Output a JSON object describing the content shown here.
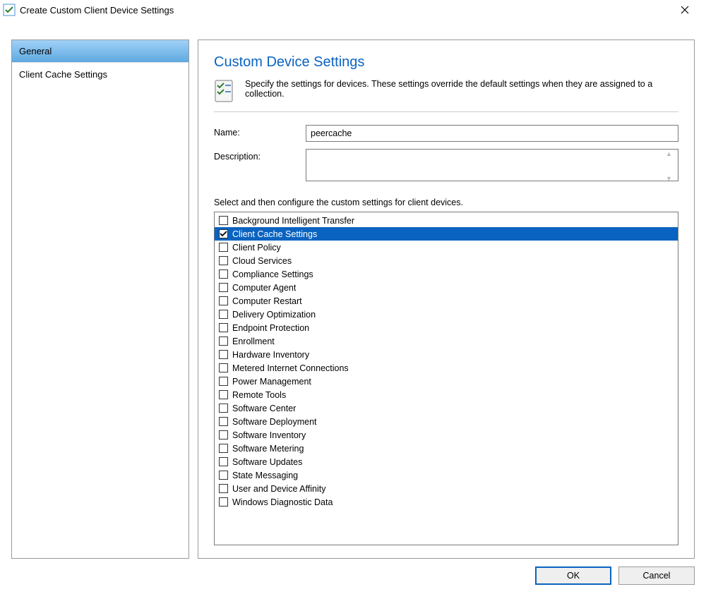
{
  "window": {
    "title": "Create Custom Client Device Settings"
  },
  "nav": {
    "items": [
      {
        "label": "General",
        "selected": true
      },
      {
        "label": "Client Cache Settings",
        "selected": false
      }
    ]
  },
  "content": {
    "heading": "Custom Device Settings",
    "intro": "Specify the settings for devices. These settings override the default settings when they are assigned to a collection.",
    "name_label": "Name:",
    "name_value": "peercache",
    "description_label": "Description:",
    "description_value": "",
    "list_label": "Select and then configure the custom settings for client devices.",
    "options": [
      {
        "label": "Background Intelligent Transfer",
        "checked": false,
        "selected": false
      },
      {
        "label": "Client Cache Settings",
        "checked": true,
        "selected": true
      },
      {
        "label": "Client Policy",
        "checked": false,
        "selected": false
      },
      {
        "label": "Cloud Services",
        "checked": false,
        "selected": false
      },
      {
        "label": "Compliance Settings",
        "checked": false,
        "selected": false
      },
      {
        "label": "Computer Agent",
        "checked": false,
        "selected": false
      },
      {
        "label": "Computer Restart",
        "checked": false,
        "selected": false
      },
      {
        "label": "Delivery Optimization",
        "checked": false,
        "selected": false
      },
      {
        "label": "Endpoint Protection",
        "checked": false,
        "selected": false
      },
      {
        "label": "Enrollment",
        "checked": false,
        "selected": false
      },
      {
        "label": "Hardware Inventory",
        "checked": false,
        "selected": false
      },
      {
        "label": "Metered Internet Connections",
        "checked": false,
        "selected": false
      },
      {
        "label": "Power Management",
        "checked": false,
        "selected": false
      },
      {
        "label": "Remote Tools",
        "checked": false,
        "selected": false
      },
      {
        "label": "Software Center",
        "checked": false,
        "selected": false
      },
      {
        "label": "Software Deployment",
        "checked": false,
        "selected": false
      },
      {
        "label": "Software Inventory",
        "checked": false,
        "selected": false
      },
      {
        "label": "Software Metering",
        "checked": false,
        "selected": false
      },
      {
        "label": "Software Updates",
        "checked": false,
        "selected": false
      },
      {
        "label": "State Messaging",
        "checked": false,
        "selected": false
      },
      {
        "label": "User and Device Affinity",
        "checked": false,
        "selected": false
      },
      {
        "label": "Windows Diagnostic Data",
        "checked": false,
        "selected": false
      }
    ]
  },
  "buttons": {
    "ok": "OK",
    "cancel": "Cancel"
  }
}
